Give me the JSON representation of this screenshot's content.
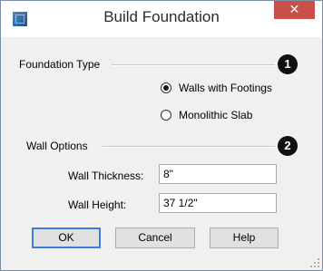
{
  "window": {
    "title": "Build Foundation",
    "close_glyph": "✕"
  },
  "foundation_type": {
    "label": "Foundation Type",
    "badge": "1",
    "options": [
      {
        "label": "Walls with Footings",
        "selected": true
      },
      {
        "label": "Monolithic Slab",
        "selected": false
      }
    ]
  },
  "wall_options": {
    "label": "Wall Options",
    "badge": "2",
    "thickness_label": "Wall Thickness:",
    "thickness_value": "8\"",
    "height_label": "Wall Height:",
    "height_value": "37 1/2\""
  },
  "buttons": {
    "ok": "OK",
    "cancel": "Cancel",
    "help": "Help"
  },
  "colors": {
    "close_button": "#c7504a",
    "default_button_border": "#3c7fd8",
    "badge": "#111111"
  },
  "icons": {
    "app": "app-icon",
    "close": "close-icon",
    "resize": "resize-grip-icon"
  }
}
